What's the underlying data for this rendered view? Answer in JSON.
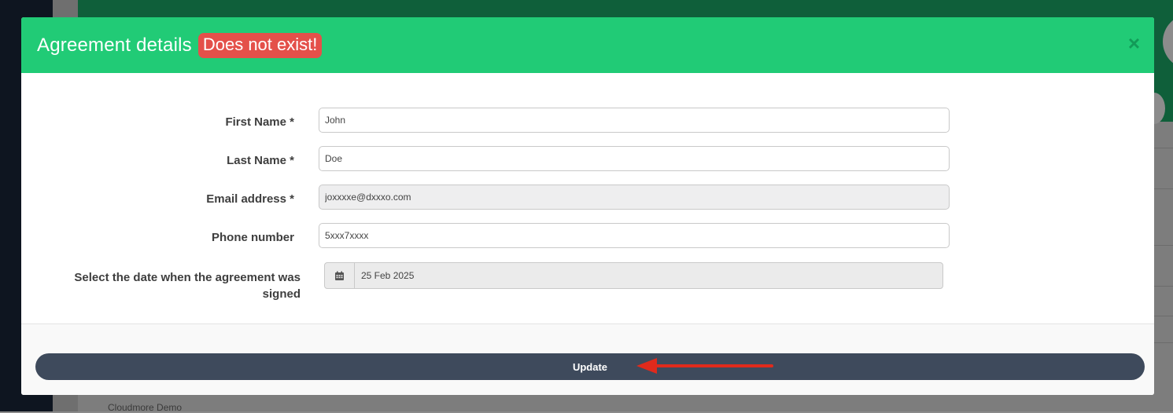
{
  "background": {
    "footer_text": "Cloudmore Demo"
  },
  "modal": {
    "title": "Agreement details",
    "status_badge": "Does not exist!",
    "close_symbol": "×",
    "colors": {
      "header": "#21cb76",
      "badge": "#e4504a",
      "button": "#3e4a5c",
      "arrow": "#e02a1c"
    }
  },
  "form": {
    "first_name": {
      "label": "First Name *",
      "value": "John"
    },
    "last_name": {
      "label": "Last Name *",
      "value": "Doe"
    },
    "email": {
      "label": "Email address *",
      "value": "joxxxxe@dxxxo.com"
    },
    "phone": {
      "label": "Phone number",
      "value": "5xxx7xxxx"
    },
    "signed_date": {
      "label": "Select the date when the agreement was signed",
      "value": "25 Feb 2025",
      "icon": "calendar-icon"
    }
  },
  "footer": {
    "update_label": "Update",
    "annotation": "arrow-pointing-to-update"
  }
}
